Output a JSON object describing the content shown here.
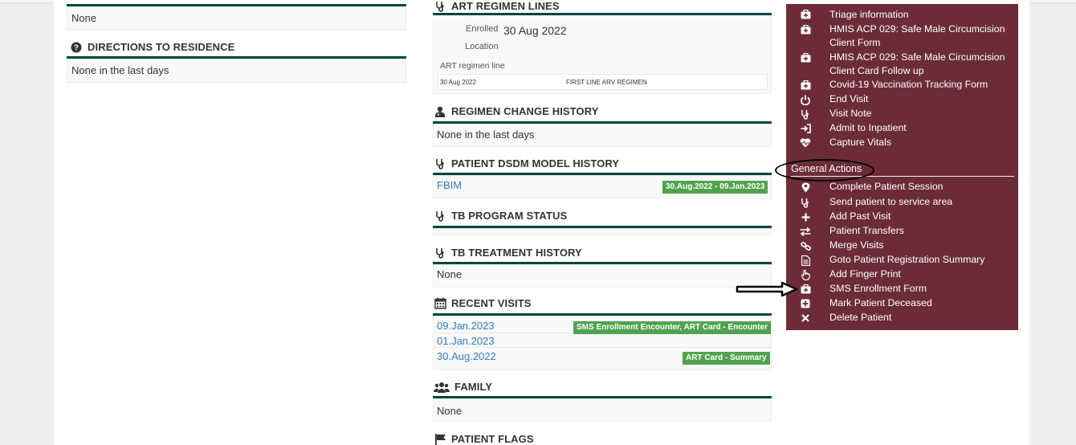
{
  "left": {
    "top_value": "None",
    "directions": {
      "title": "DIRECTIONS TO RESIDENCE",
      "value": "None in the last days"
    }
  },
  "middle": {
    "art_regimen": {
      "title": "ART REGIMEN LINES",
      "enrolled_label": "Enrolled",
      "enrolled_value": "30 Aug 2022",
      "location_label": "Location",
      "line_label": "ART regimen line",
      "row_date": "30 Aug 2022",
      "row_regimen": "FIRST LINE ARV REGIMEN"
    },
    "regimen_change": {
      "title": "REGIMEN CHANGE HISTORY",
      "value": "None in the last days"
    },
    "dsdm": {
      "title": "PATIENT DSDM MODEL HISTORY",
      "link": "FBIM",
      "badge": "30.Aug.2022 - 09.Jan.2023"
    },
    "tb_program": {
      "title": "TB PROGRAM STATUS"
    },
    "tb_treatment": {
      "title": "TB TREATMENT HISTORY",
      "value": "None"
    },
    "recent_visits": {
      "title": "RECENT VISITS",
      "visits": [
        {
          "date": "09.Jan.2023",
          "badge": "SMS Enrollment Encounter, ART Card - Encounter"
        },
        {
          "date": "01.Jan.2023",
          "badge": ""
        },
        {
          "date": "30.Aug.2022",
          "badge": "ART Card - Summary"
        }
      ]
    },
    "family": {
      "title": "FAMILY",
      "value": "None"
    },
    "flags": {
      "title": "PATIENT FLAGS"
    }
  },
  "actions_panel": {
    "items": [
      {
        "label": "Triage information",
        "icon": "medkit-icon"
      },
      {
        "label": "HMIS ACP 029: Safe Male Circumcision",
        "label2": "Client Form",
        "icon": "medkit-icon"
      },
      {
        "label": "HMIS ACP 029: Safe Male Circumcision",
        "label2": "Client Card Follow up",
        "icon": "medkit-icon"
      },
      {
        "label": "Covid-19 Vaccination Tracking Form",
        "icon": "medkit-icon"
      },
      {
        "label": "End Visit",
        "icon": "power-icon"
      },
      {
        "label": "Visit Note",
        "icon": "stethoscope-icon"
      },
      {
        "label": "Admit to Inpatient",
        "icon": "sign-in-icon"
      },
      {
        "label": "Capture Vitals",
        "icon": "heartbeat-icon"
      }
    ],
    "general_actions_title": "General Actions",
    "general_actions": [
      {
        "label": "Complete Patient Session",
        "icon": "map-marker-icon"
      },
      {
        "label": "Send patient to service area",
        "icon": "stethoscope-icon"
      },
      {
        "label": "Add Past Visit",
        "icon": "plus-icon"
      },
      {
        "label": "Patient Transfers",
        "icon": "exchange-icon"
      },
      {
        "label": "Merge Visits",
        "icon": "link-icon"
      },
      {
        "label": "Goto Patient Registration Summary",
        "icon": "file-icon"
      },
      {
        "label": "Add Finger Print",
        "icon": "hand-pointer-icon"
      },
      {
        "label": "SMS Enrollment Form",
        "icon": "medkit-icon"
      },
      {
        "label": "Mark Patient Deceased",
        "icon": "plus-square-icon"
      },
      {
        "label": "Delete Patient",
        "icon": "times-icon"
      }
    ]
  },
  "colors": {
    "section_bar": "#00463f",
    "panel_bg": "#6b2c38",
    "badge_bg": "#51a351",
    "link": "#337ab7"
  }
}
